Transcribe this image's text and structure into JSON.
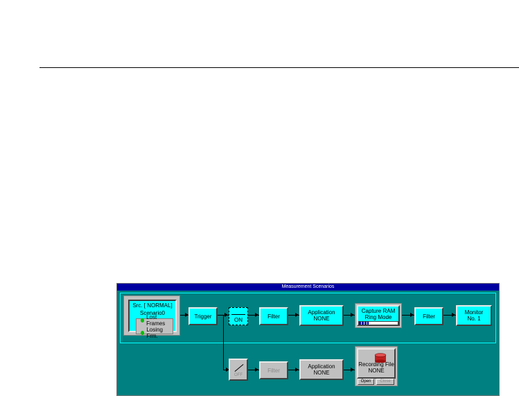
{
  "window": {
    "title": "Measurement Scenarios"
  },
  "colors": {
    "teal": "#008080",
    "cyan": "#00ffff",
    "grey": "#c0c0c0",
    "title_bar": "#0000a0"
  },
  "source": {
    "line1": "Src. [ NORMAL]",
    "line2": "Scenario0",
    "status": [
      "Lost Frames",
      "Losing Frm."
    ]
  },
  "top_path": {
    "trigger": "Trigger",
    "switch": "ON",
    "filter": "Filter",
    "application": {
      "line1": "Application",
      "line2": "NONE"
    },
    "capture": {
      "line1": "Capture RAM",
      "line2": "Ring Mode",
      "progress_fraction": 0.25
    },
    "filter2": "Filter",
    "monitor": {
      "line1": "Monitor",
      "line2": "No. 1"
    }
  },
  "bottom_path": {
    "switch": "OFF",
    "filter": "Filter",
    "application": {
      "line1": "Application",
      "line2": "NONE"
    },
    "recording": {
      "line1": "Recording File",
      "line2": "NONE",
      "open_label": "Open",
      "close_label": "Close",
      "icon": "database-icon"
    }
  }
}
